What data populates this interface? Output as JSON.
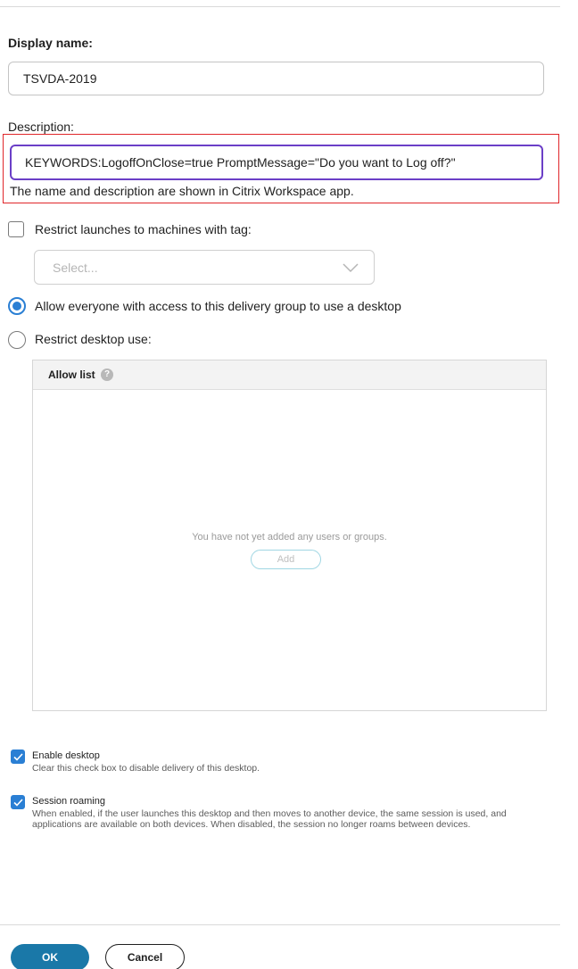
{
  "display_name": {
    "label": "Display name:",
    "value": "TSVDA-2019"
  },
  "description": {
    "label": "Description:",
    "value": "KEYWORDS:LogoffOnClose=true PromptMessage=\"Do you want to Log off?\"",
    "hint": "The name and description are shown in Citrix Workspace app."
  },
  "restrict_tag": {
    "label": "Restrict launches to machines with tag:",
    "checked": false,
    "select_placeholder": "Select..."
  },
  "desktop_use": {
    "allow_everyone_label": "Allow everyone with access to this delivery group to use a desktop",
    "restrict_label": "Restrict desktop use:",
    "selected": "allow_everyone"
  },
  "allow_list": {
    "title": "Allow list",
    "help_glyph": "?",
    "empty_message": "You have not yet added any users or groups.",
    "add_label": "Add"
  },
  "enable_desktop": {
    "title": "Enable desktop",
    "description": "Clear this check box to disable delivery of this desktop.",
    "checked": true
  },
  "session_roaming": {
    "title": "Session roaming",
    "description": "When enabled, if the user launches this desktop and then moves to another device, the same session is used, and applications are available on both devices. When disabled, the session no longer roams between devices.",
    "checked": true
  },
  "footer": {
    "ok_label": "OK",
    "cancel_label": "Cancel"
  },
  "colors": {
    "accent": "#2a7fd4",
    "primary_button": "#1a78a8",
    "focus_border": "#6b3fc7",
    "highlight_box": "#e0262a"
  }
}
